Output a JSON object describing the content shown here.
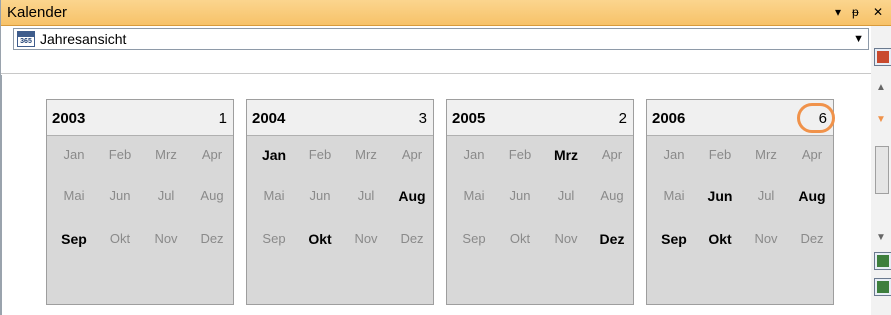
{
  "window": {
    "title": "Kalender",
    "buttons": [
      "▾",
      "ᵽ",
      "✕"
    ]
  },
  "toolbar": {
    "view_label": "Jahresansicht",
    "icon_number": "365"
  },
  "years": [
    {
      "year": "2003",
      "count": "1",
      "months": [
        [
          "Jan",
          "Feb",
          "Mrz",
          "Apr"
        ],
        [
          "Mai",
          "Jun",
          "Jul",
          "Aug"
        ],
        [
          "Sep",
          "Okt",
          "Nov",
          "Dez"
        ]
      ],
      "active": [
        "Sep"
      ]
    },
    {
      "year": "2004",
      "count": "3",
      "months": [
        [
          "Jan",
          "Feb",
          "Mrz",
          "Apr"
        ],
        [
          "Mai",
          "Jun",
          "Jul",
          "Aug"
        ],
        [
          "Sep",
          "Okt",
          "Nov",
          "Dez"
        ]
      ],
      "active": [
        "Jan",
        "Aug",
        "Okt"
      ]
    },
    {
      "year": "2005",
      "count": "2",
      "months": [
        [
          "Jan",
          "Feb",
          "Mrz",
          "Apr"
        ],
        [
          "Mai",
          "Jun",
          "Jul",
          "Aug"
        ],
        [
          "Sep",
          "Okt",
          "Nov",
          "Dez"
        ]
      ],
      "active": [
        "Mrz",
        "Dez"
      ]
    },
    {
      "year": "2006",
      "count": "6",
      "highlighted": true,
      "months": [
        [
          "Jan",
          "Feb",
          "Mrz",
          "Apr"
        ],
        [
          "Mai",
          "Jun",
          "Jul",
          "Aug"
        ],
        [
          "Sep",
          "Okt",
          "Nov",
          "Dez"
        ]
      ],
      "active": [
        "Jun",
        "Aug",
        "Sep",
        "Okt"
      ]
    }
  ],
  "colors": {
    "titlebar": "#f7c269",
    "active_month": "#000000",
    "inactive_month": "#8a8a8a",
    "highlight": "#f0924a"
  }
}
